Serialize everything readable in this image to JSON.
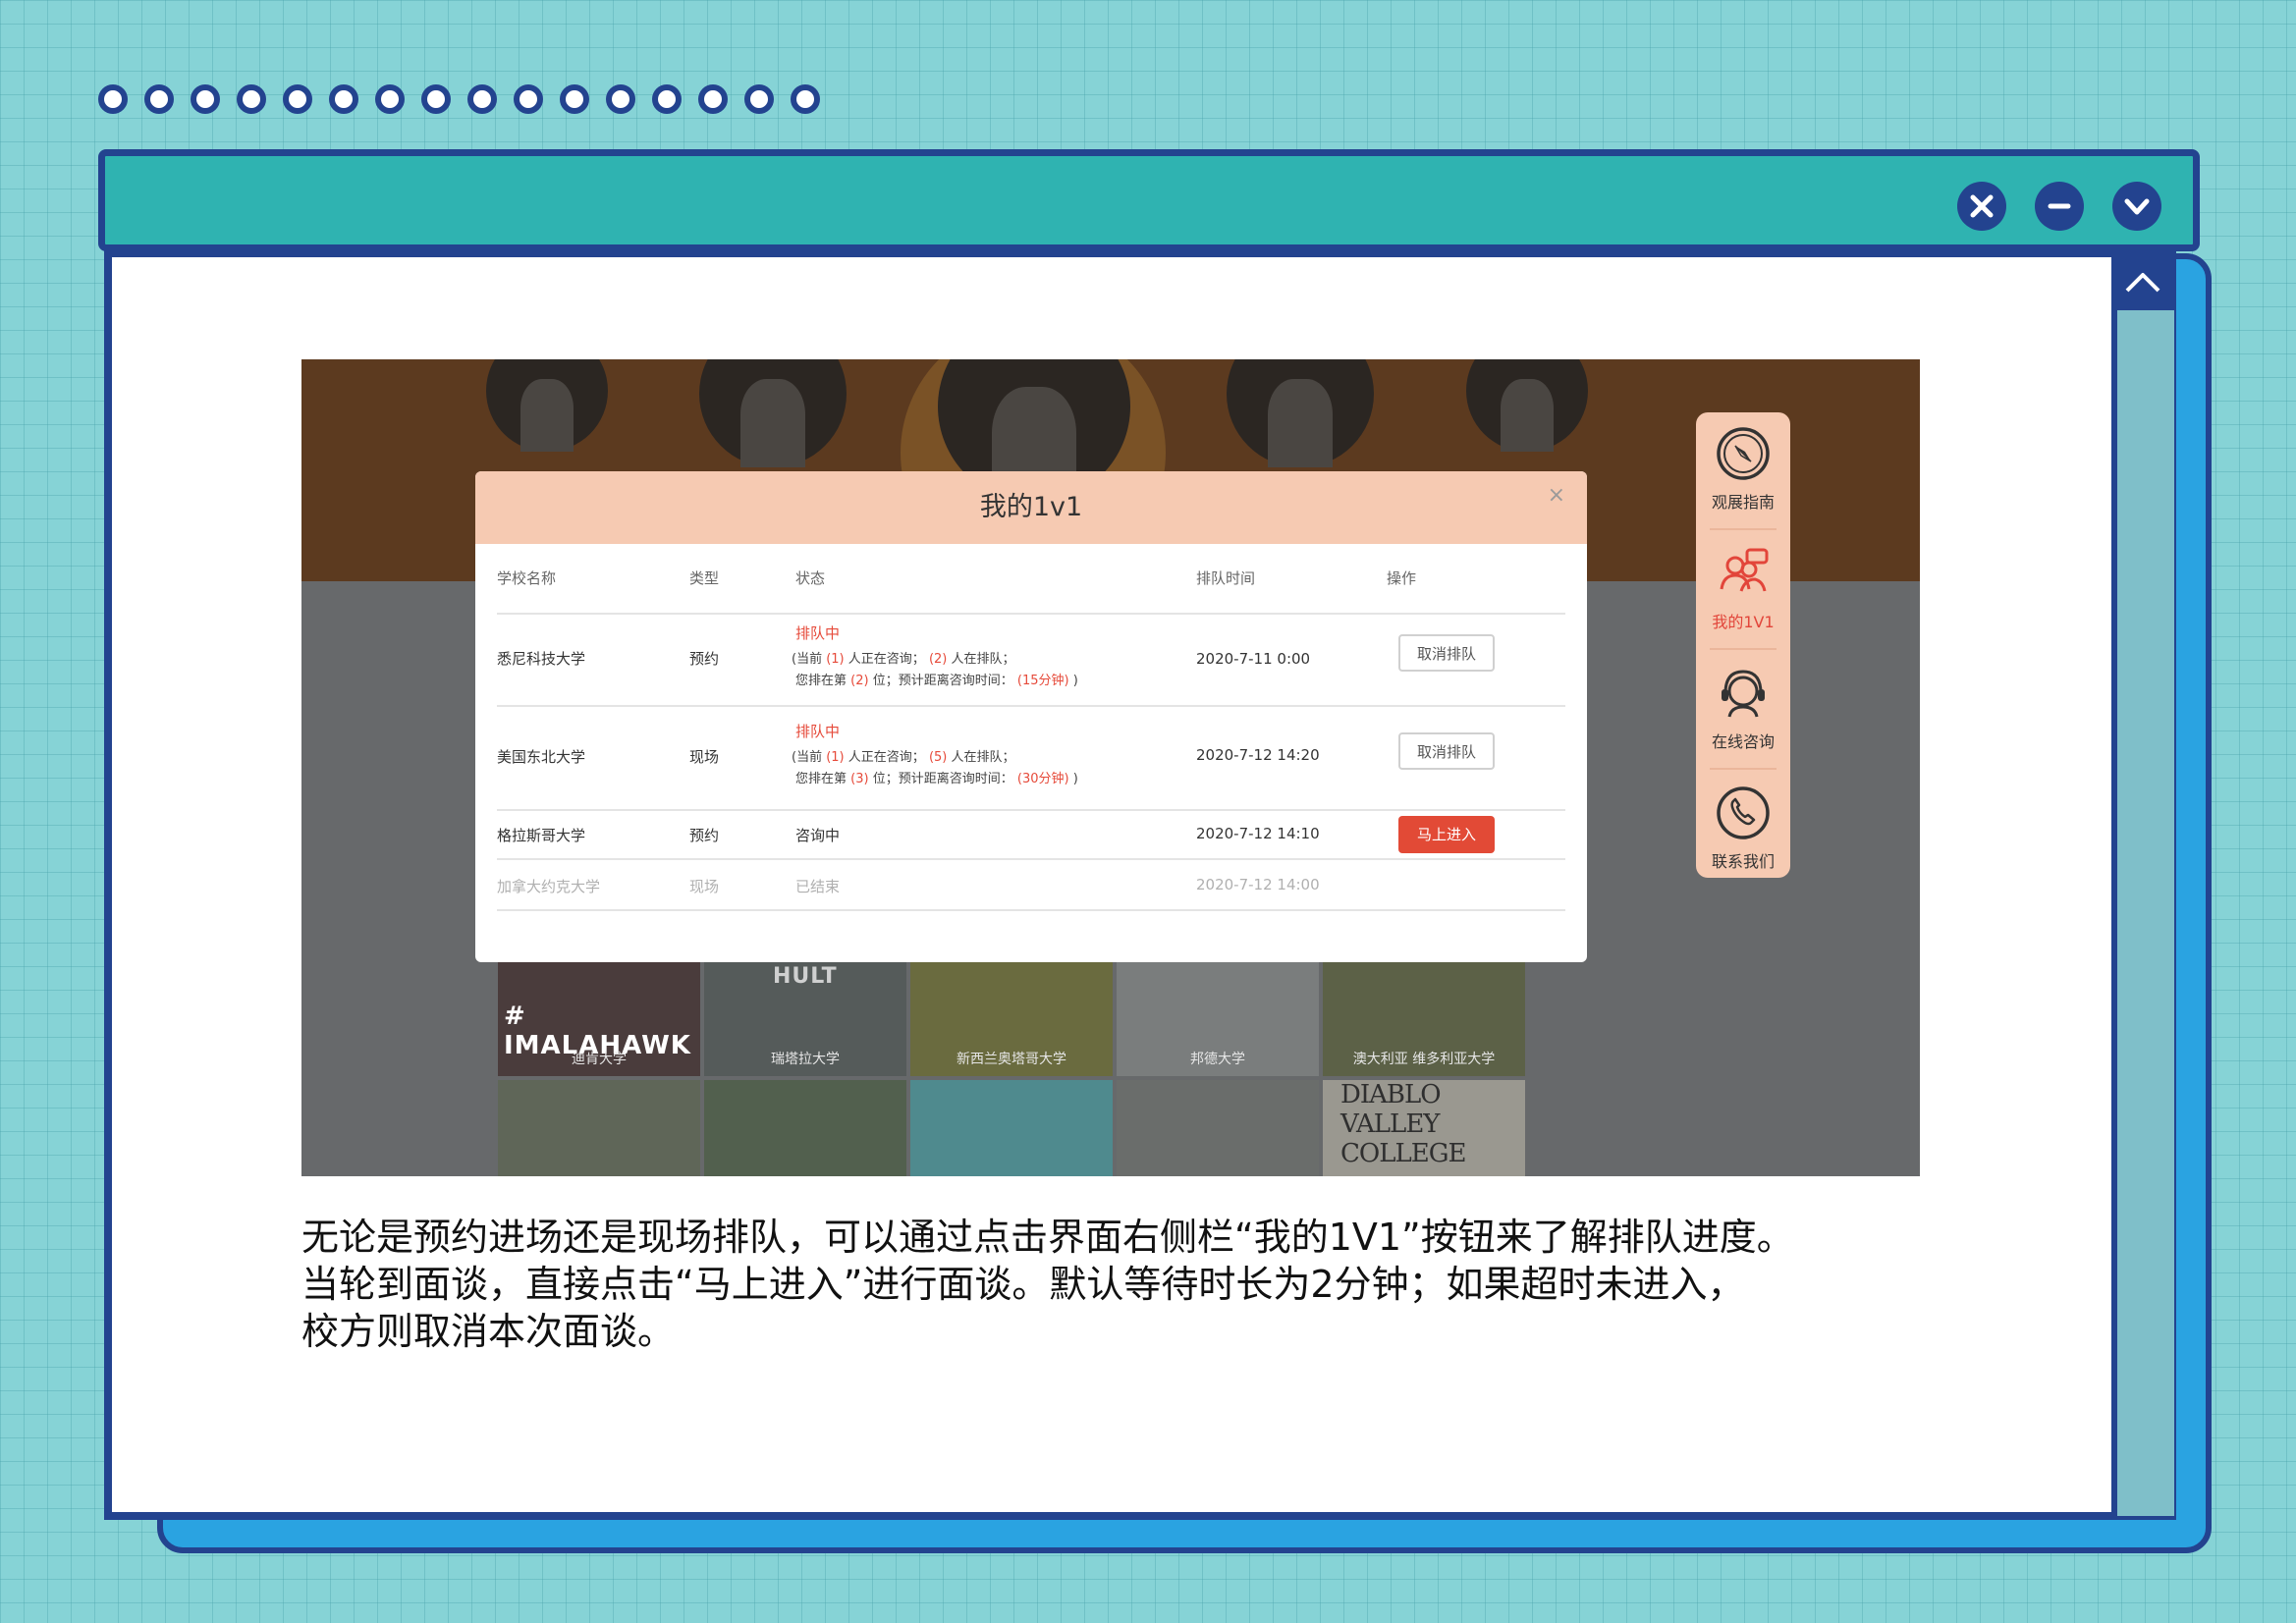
{
  "window": {
    "controls": [
      "close-icon",
      "minimize-icon",
      "chevron-down-icon"
    ],
    "scroll_up_icon": "chevron-up-icon"
  },
  "modal": {
    "title": "我的1v1",
    "close": "×",
    "columns": [
      "学校名称",
      "类型",
      "状态",
      "排队时间",
      "操作"
    ],
    "rows": [
      {
        "school": "悉尼科技大学",
        "type": "预约",
        "status": "排队中",
        "line1": [
          "(当前",
          "(1)",
          "人正在咨询；",
          "(2)",
          "人在排队；"
        ],
        "line2": [
          "您排在第",
          "(2)",
          "位；预计距离咨询时间：",
          "(15分钟)",
          ")"
        ],
        "time": "2020-7-11 0:00",
        "action": "取消排队"
      },
      {
        "school": "美国东北大学",
        "type": "现场",
        "status": "排队中",
        "line1": [
          "(当前",
          "(1)",
          "人正在咨询；",
          "(5)",
          "人在排队；"
        ],
        "line2": [
          "您排在第",
          "(3)",
          "位；预计距离咨询时间：",
          "(30分钟)",
          ")"
        ],
        "time": "2020-7-12 14:20",
        "action": "取消排队"
      },
      {
        "school": "格拉斯哥大学",
        "type": "预约",
        "status": "咨询中",
        "time": "2020-7-12 14:10",
        "action": "马上进入"
      },
      {
        "school": "加拿大约克大学",
        "type": "现场",
        "status": "已结束",
        "time": "2020-7-12 14:00"
      }
    ]
  },
  "sidebar": [
    {
      "icon": "compass-icon",
      "label": "观展指南",
      "active": false
    },
    {
      "icon": "users-chat-icon",
      "label": "我的1V1",
      "active": true
    },
    {
      "icon": "headset-icon",
      "label": "在线咨询",
      "active": false
    },
    {
      "icon": "phone-icon",
      "label": "联系我们",
      "active": false
    }
  ],
  "thumbs": {
    "row1_labels": [
      "迪肯大学",
      "瑞塔拉大学",
      "新西兰奥塔哥大学",
      "邦德大学",
      "澳大利亚 维多利亚大学"
    ],
    "tag1": "# IMALAHAWK",
    "tag2": "HULT",
    "sign": "DIABLO VALLEY COLLEGE"
  },
  "description": {
    "line1": "无论是预约进场还是现场排队，可以通过点击界面右侧栏“我的1V1”按钮来了解排队进度。",
    "line2": "当轮到面谈，直接点击“马上进入”进行面谈。默认等待时长为2分钟；如果超时未进入，",
    "line3": "校方则取消本次面谈。"
  },
  "colors": {
    "frame": "#23438f",
    "titlebar": "#2fb3b1",
    "accent_red": "#e24a36",
    "modal_header": "#f6cab2"
  }
}
